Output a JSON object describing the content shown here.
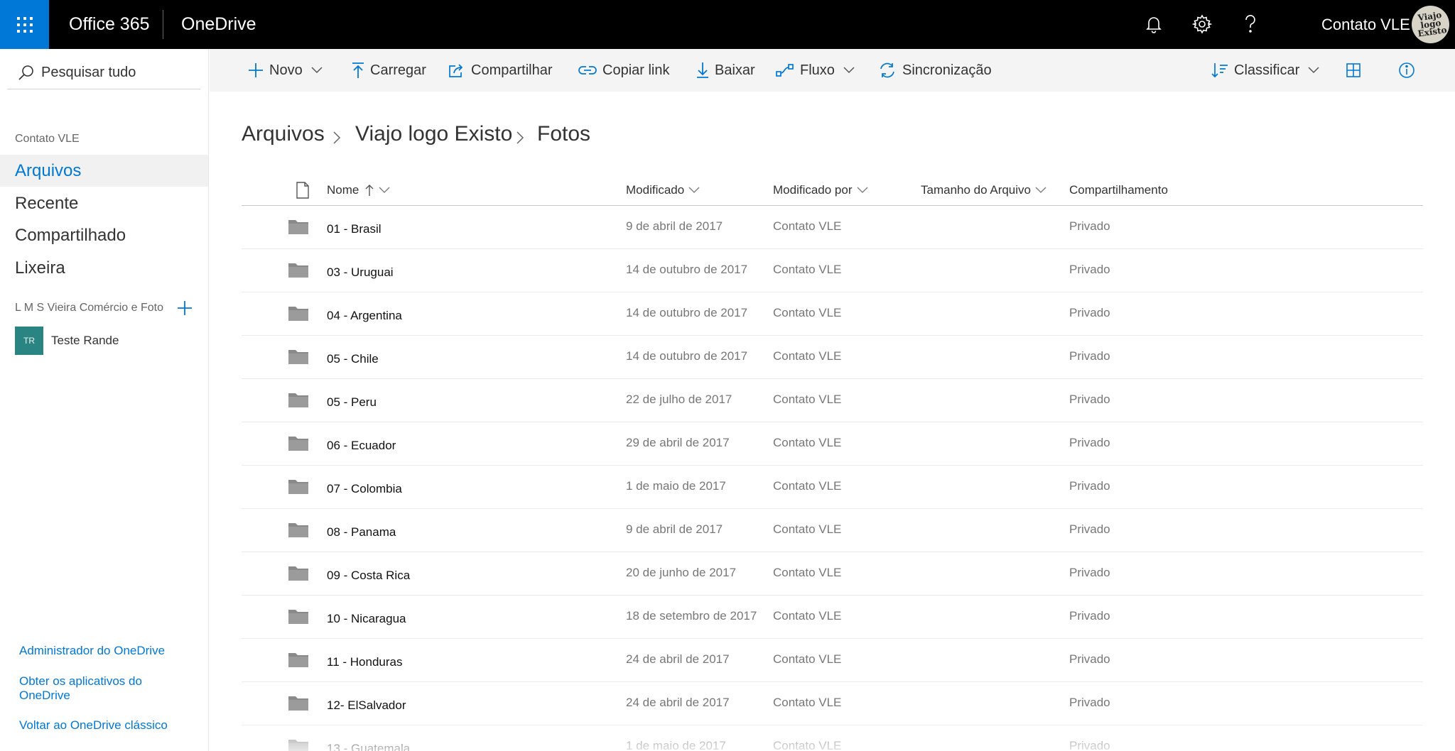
{
  "suite": {
    "brand": "Office 365",
    "app": "OneDrive",
    "user": "Contato VLE",
    "avatar_text": "Viajo logo Existo"
  },
  "leftnav": {
    "search_label": "Pesquisar tudo",
    "section_label": "Contato VLE",
    "items": [
      {
        "label": "Arquivos",
        "selected": true
      },
      {
        "label": "Recente"
      },
      {
        "label": "Compartilhado"
      },
      {
        "label": "Lixeira"
      }
    ],
    "group_section": "L M S Vieira Comércio e Foto",
    "group": {
      "initials": "TR",
      "name": "Teste Rande"
    },
    "footer_links": [
      "Administrador do OneDrive",
      "Obter os aplicativos do OneDrive",
      "Voltar ao OneDrive clássico"
    ]
  },
  "commandbar": {
    "novo": "Novo",
    "carregar": "Carregar",
    "compartilhar": "Compartilhar",
    "copiar_link": "Copiar link",
    "baixar": "Baixar",
    "fluxo": "Fluxo",
    "sincronizacao": "Sincronização",
    "classificar": "Classificar"
  },
  "breadcrumb": [
    "Arquivos",
    "Viajo logo Existo",
    "Fotos"
  ],
  "columns": {
    "nome": "Nome",
    "modificado": "Modificado",
    "modificado_por": "Modificado por",
    "tamanho": "Tamanho do Arquivo",
    "compartilhamento": "Compartilhamento"
  },
  "rows": [
    {
      "name": "01 - Brasil",
      "modified": "9 de abril de 2017",
      "by": "Contato VLE",
      "sharing": "Privado"
    },
    {
      "name": "03 - Uruguai",
      "modified": "14 de outubro de 2017",
      "by": "Contato VLE",
      "sharing": "Privado"
    },
    {
      "name": "04 - Argentina",
      "modified": "14 de outubro de 2017",
      "by": "Contato VLE",
      "sharing": "Privado"
    },
    {
      "name": "05 - Chile",
      "modified": "14 de outubro de 2017",
      "by": "Contato VLE",
      "sharing": "Privado"
    },
    {
      "name": "05 - Peru",
      "modified": "22 de julho de 2017",
      "by": "Contato VLE",
      "sharing": "Privado"
    },
    {
      "name": "06 - Ecuador",
      "modified": "29 de abril de 2017",
      "by": "Contato VLE",
      "sharing": "Privado"
    },
    {
      "name": "07 - Colombia",
      "modified": "1 de maio de 2017",
      "by": "Contato VLE",
      "sharing": "Privado"
    },
    {
      "name": "08 - Panama",
      "modified": "9 de abril de 2017",
      "by": "Contato VLE",
      "sharing": "Privado"
    },
    {
      "name": "09 - Costa Rica",
      "modified": "20 de junho de 2017",
      "by": "Contato VLE",
      "sharing": "Privado"
    },
    {
      "name": "10 - Nicaragua",
      "modified": "18 de setembro de 2017",
      "by": "Contato VLE",
      "sharing": "Privado"
    },
    {
      "name": "11 - Honduras",
      "modified": "24 de abril de 2017",
      "by": "Contato VLE",
      "sharing": "Privado"
    },
    {
      "name": "12- ElSalvador",
      "modified": "24 de abril de 2017",
      "by": "Contato VLE",
      "sharing": "Privado"
    },
    {
      "name": "13 - Guatemala",
      "modified": "1 de maio de 2017",
      "by": "Contato VLE",
      "sharing": "Privado"
    }
  ],
  "colors": {
    "accent": "#0078d7",
    "suite_bar": "#000000",
    "commandbar_bg": "#f4f4f4",
    "folder": "#8a8a8a",
    "group_badge": "#2a8582"
  }
}
